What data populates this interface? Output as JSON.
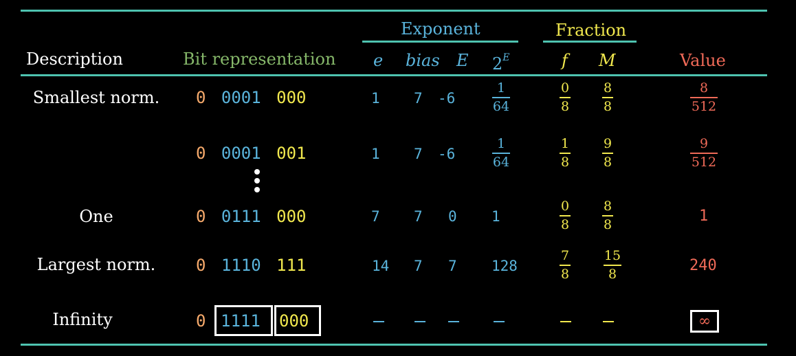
{
  "header": {
    "description": "Description",
    "bit_representation": "Bit representation",
    "exponent_group": "Exponent",
    "fraction_group": "Fraction",
    "col_e": "e",
    "col_bias": "bias",
    "col_E": "E",
    "col_2E_base": "2",
    "col_2E_sup": "E",
    "col_f": "f",
    "col_M": "M",
    "col_value": "Value"
  },
  "rows": [
    {
      "description": "Smallest norm.",
      "sign": "0",
      "exp_bits": "0001",
      "frac_bits": "000",
      "e": "1",
      "bias": "7",
      "E": "-6",
      "two_E": {
        "num": "1",
        "den": "64"
      },
      "f": {
        "num": "0",
        "den": "8"
      },
      "M": {
        "num": "8",
        "den": "8"
      },
      "value": {
        "num": "8",
        "den": "512"
      }
    },
    {
      "description": "",
      "sign": "0",
      "exp_bits": "0001",
      "frac_bits": "001",
      "e": "1",
      "bias": "7",
      "E": "-6",
      "two_E": {
        "num": "1",
        "den": "64"
      },
      "f": {
        "num": "1",
        "den": "8"
      },
      "M": {
        "num": "9",
        "den": "8"
      },
      "value": {
        "num": "9",
        "den": "512"
      }
    },
    {
      "description": "One",
      "sign": "0",
      "exp_bits": "0111",
      "frac_bits": "000",
      "e": "7",
      "bias": "7",
      "E": "0",
      "two_E": "1",
      "f": {
        "num": "0",
        "den": "8"
      },
      "M": {
        "num": "8",
        "den": "8"
      },
      "value": "1"
    },
    {
      "description": "Largest norm.",
      "sign": "0",
      "exp_bits": "1110",
      "frac_bits": "111",
      "e": "14",
      "bias": "7",
      "E": "7",
      "two_E": "128",
      "f": {
        "num": "7",
        "den": "8"
      },
      "M": {
        "num": "15",
        "den": "8"
      },
      "value": "240"
    },
    {
      "description": "Infinity",
      "sign": "0",
      "exp_bits": "1111",
      "frac_bits": "000",
      "value": "∞"
    }
  ],
  "colors": {
    "rule": "#4ec3b0",
    "sign": "#f5a96b",
    "exponent": "#5ab4dc",
    "fraction": "#f2e94e",
    "value": "#f06a58",
    "bit_header": "#86b86a"
  }
}
